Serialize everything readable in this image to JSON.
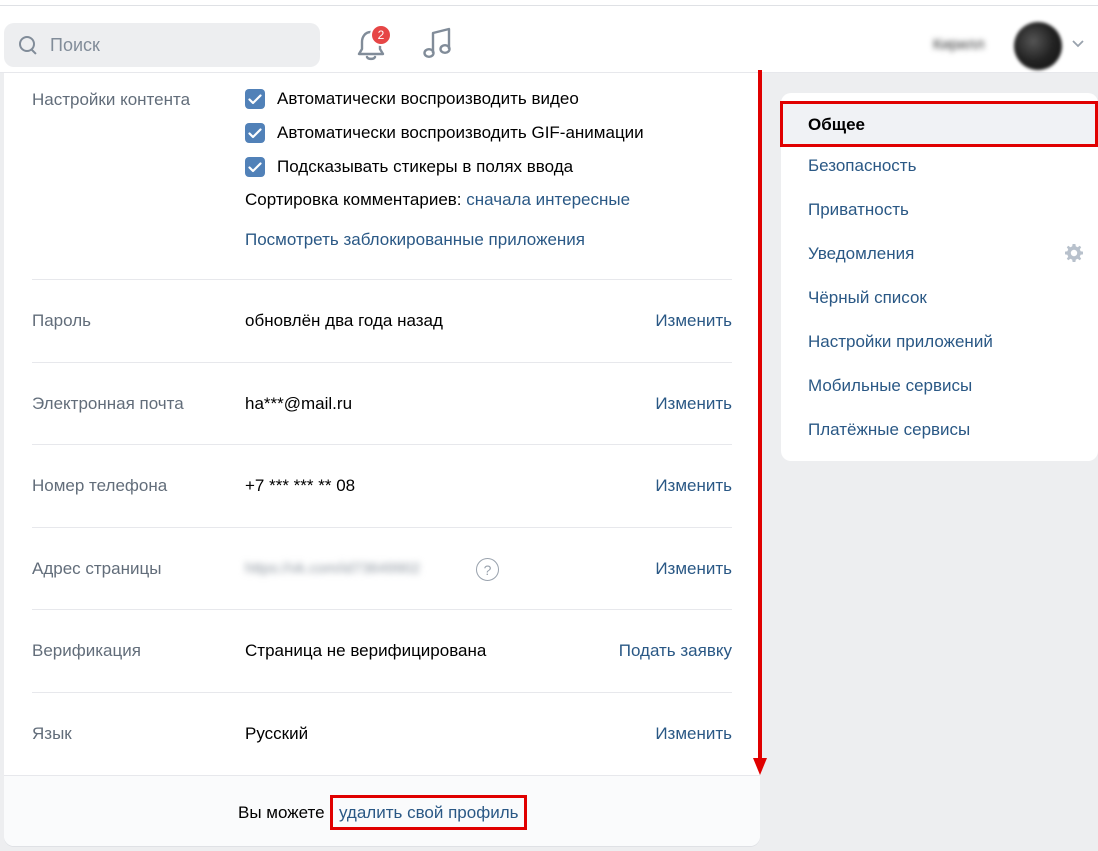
{
  "header": {
    "search_placeholder": "Поиск",
    "notifications_count": "2",
    "user_name": "Кирилл"
  },
  "content_settings": {
    "label": "Настройки контента",
    "checkboxes": [
      {
        "label": "Автоматически воспроизводить видео",
        "checked": true
      },
      {
        "label": "Автоматически воспроизводить GIF-анимации",
        "checked": true
      },
      {
        "label": "Подсказывать стикеры в полях ввода",
        "checked": true
      }
    ],
    "sort_label": "Сортировка комментариев:",
    "sort_value": "сначала интересные",
    "blocked_apps_link": "Посмотреть заблокированные приложения"
  },
  "rows": {
    "password": {
      "label": "Пароль",
      "value": "обновлён два года назад",
      "action": "Изменить"
    },
    "email": {
      "label": "Электронная почта",
      "value": "ha***@mail.ru",
      "action": "Изменить"
    },
    "phone": {
      "label": "Номер телефона",
      "value": "+7 *** *** ** 08",
      "action": "Изменить"
    },
    "address": {
      "label": "Адрес страницы",
      "value": "https://vk.com/id73649902",
      "help": "?",
      "action": "Изменить"
    },
    "verification": {
      "label": "Верификация",
      "value": "Страница не верифицирована",
      "action": "Подать заявку"
    },
    "language": {
      "label": "Язык",
      "value": "Русский",
      "action": "Изменить"
    }
  },
  "footer": {
    "text": "Вы можете",
    "link": "удалить свой профиль"
  },
  "menu": {
    "active": "Общее",
    "items": [
      "Безопасность",
      "Приватность",
      "Уведомления",
      "Чёрный список",
      "Настройки приложений",
      "Мобильные сервисы",
      "Платёжные сервисы"
    ]
  },
  "colors": {
    "accent_link": "#2a5885",
    "highlight_red": "#e00000",
    "checkbox_blue": "#5181b8"
  }
}
